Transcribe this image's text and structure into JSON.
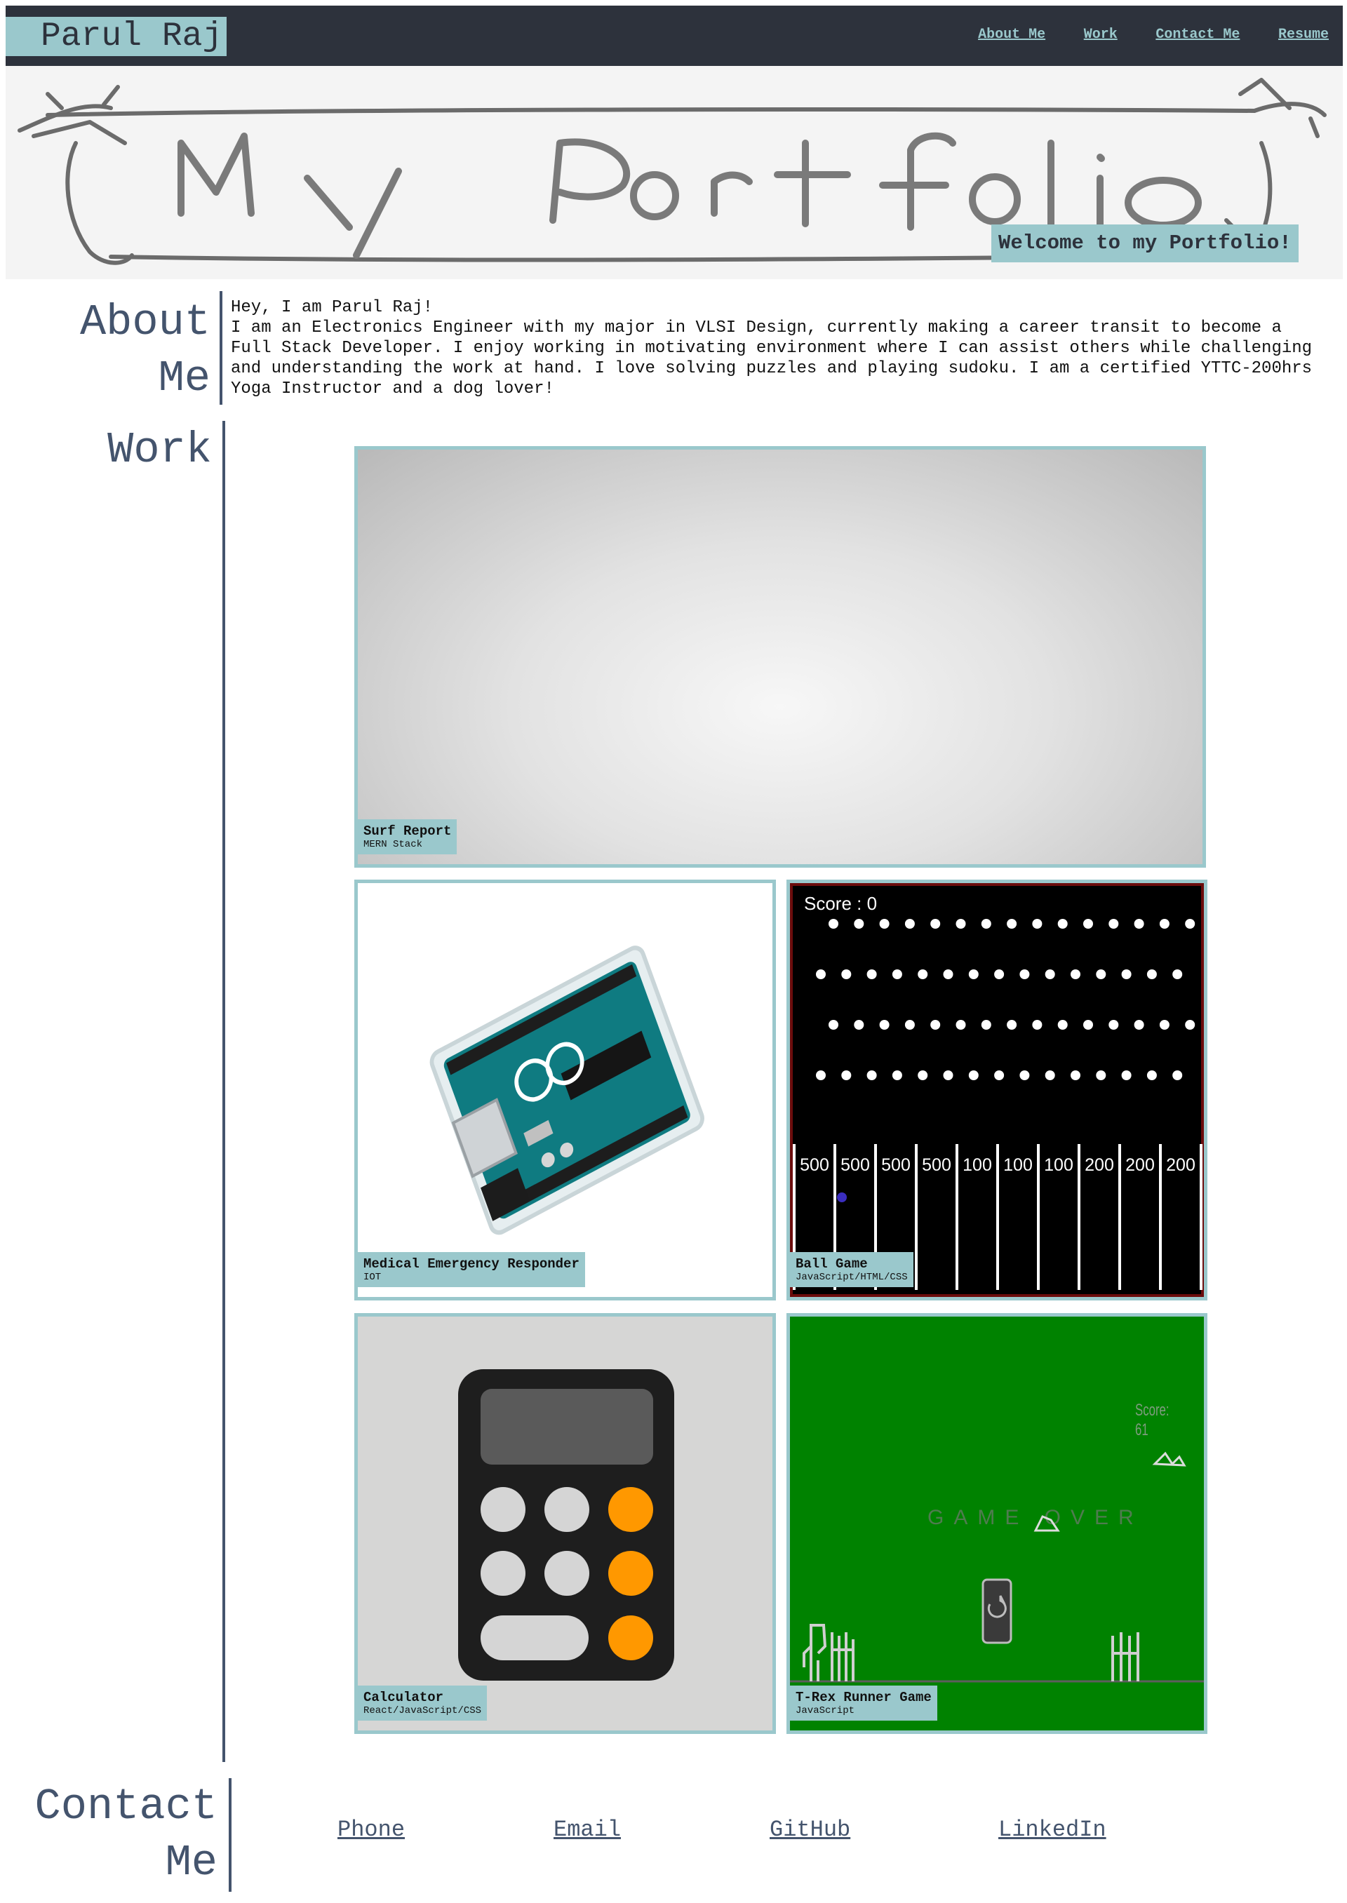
{
  "header": {
    "brand": "Parul Raj",
    "nav": [
      "About Me",
      "Work",
      "Contact Me",
      "Resume"
    ]
  },
  "hero": {
    "title_art": "My Portfolio",
    "welcome": "Welcome to my Portfolio!"
  },
  "about": {
    "title_line1": "About",
    "title_line2": "Me",
    "greeting": "Hey, I am Parul Raj!",
    "body": "I am an Electronics Engineer with my major in VLSI Design, currently making a career transit to become a Full Stack Developer. I enjoy working in motivating environment where I can assist others while challenging and understanding the work at hand. I love solving puzzles and playing sudoku. I am a certified YTTC-200hrs Yoga Instructor and a dog lover!"
  },
  "work": {
    "title": "Work",
    "projects": [
      {
        "title": "Surf Report",
        "tech": "MERN Stack"
      },
      {
        "title": "Medical Emergency Responder",
        "tech": "IOT"
      },
      {
        "title": "Ball Game",
        "tech": "JavaScript/HTML/CSS"
      },
      {
        "title": "Calculator",
        "tech": "React/JavaScript/CSS"
      },
      {
        "title": "T-Rex Runner Game",
        "tech": "JavaScript"
      }
    ],
    "ball_game": {
      "score": "Score : 0",
      "slots": [
        "500",
        "500",
        "500",
        "500",
        "100",
        "100",
        "100",
        "200",
        "200",
        "200"
      ]
    },
    "trex_game": {
      "score": "Score: 61",
      "game_over": "GAME OVER"
    }
  },
  "contact": {
    "title_line1": "Contact",
    "title_line2": "Me",
    "links": [
      "Phone",
      "Email",
      "GitHub",
      "LinkedIn"
    ]
  }
}
